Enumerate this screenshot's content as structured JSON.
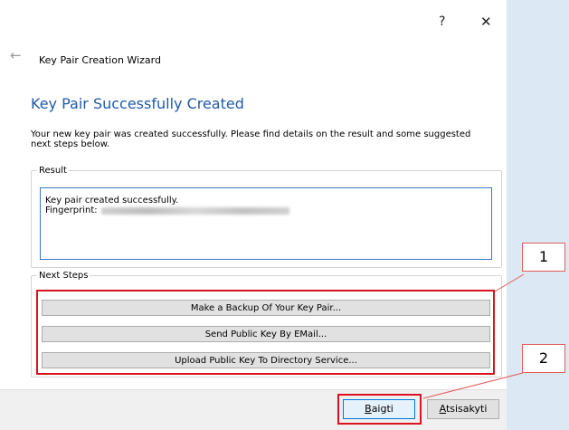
{
  "window": {
    "help_glyph": "?",
    "close_glyph": "✕",
    "back_glyph": "←",
    "wizard_title": "Key Pair Creation Wizard"
  },
  "main": {
    "heading": "Key Pair Successfully Created",
    "description": "Your new key pair was created successfully. Please find details on the result and some suggested next steps below."
  },
  "result": {
    "group_label": "Result",
    "line1": "Key pair created successfully.",
    "fingerprint_label": "Fingerprint:"
  },
  "next_steps": {
    "group_label": "Next Steps",
    "buttons": [
      "Make a Backup Of Your Key Pair...",
      "Send Public Key By EMail...",
      "Upload Public Key To Directory Service..."
    ]
  },
  "footer": {
    "finish_access_key": "B",
    "finish_rest": "aigti",
    "cancel_access_key": "A",
    "cancel_rest": "tsisakyti"
  },
  "callouts": [
    "1",
    "2"
  ],
  "colors": {
    "heading": "#1f5aa6",
    "highlight": "#d9141e",
    "focus": "#3b78c4"
  }
}
